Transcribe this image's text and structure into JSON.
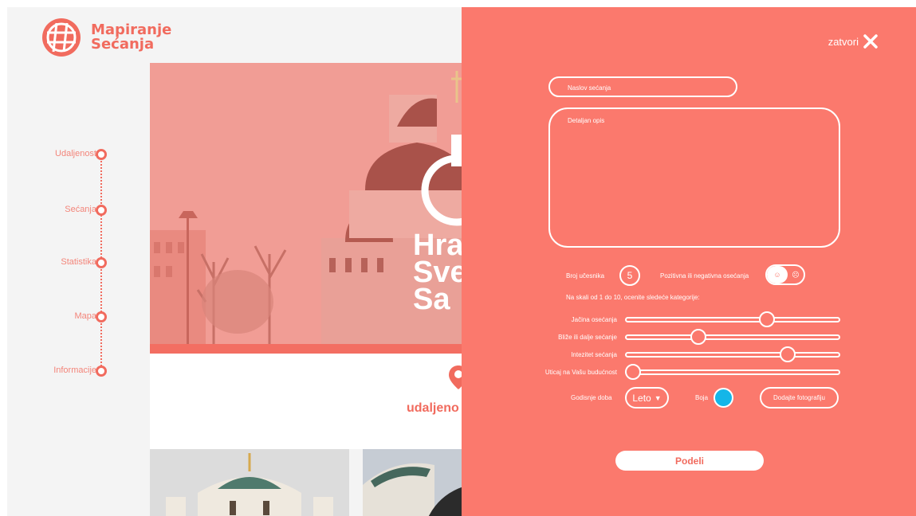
{
  "app": {
    "brand_line1": "Mapiranje",
    "brand_line2": "Sećanja"
  },
  "timeline": {
    "items": [
      {
        "label": "Udaljenost"
      },
      {
        "label": "Sećanja"
      },
      {
        "label": "Statistika"
      },
      {
        "label": "Mapa"
      },
      {
        "label": "Informacije"
      }
    ]
  },
  "hero": {
    "title_lines": [
      "Hra",
      "Sve",
      "Sa"
    ],
    "distance_label": "udaljeno"
  },
  "modal": {
    "close_label": "zatvori",
    "title_placeholder": "Naslov sećanja",
    "description_placeholder": "Detaljan opis",
    "participants_label": "Broj učesnika",
    "participants_value": "5",
    "sentiment_label": "Pozitivna ili negativna osećanja",
    "sentiment_positive_icon": "☺",
    "sentiment_negative_icon": "☹",
    "scale_instruction": "Na skali od 1 do 10, ocenite sledeće kategorije:",
    "sliders": [
      {
        "label": "Jačina osećanja",
        "value": 0.66
      },
      {
        "label": "Bliže ili dalje sećanje",
        "value": 0.34
      },
      {
        "label": "Intezitet sećanja",
        "value": 0.76
      },
      {
        "label": "Uticaj na Vašu budućnost",
        "value": 0.03
      }
    ],
    "season_label": "Godisnje doba",
    "season_value": "Leto",
    "color_label": "Boja",
    "color_value": "#14b6e8",
    "add_photo_label": "Dodajte fotografiju",
    "share_label": "Podeli"
  },
  "colors": {
    "accent": "#fb796d",
    "brand": "#f16b5e",
    "selected_color": "#14b6e8"
  }
}
